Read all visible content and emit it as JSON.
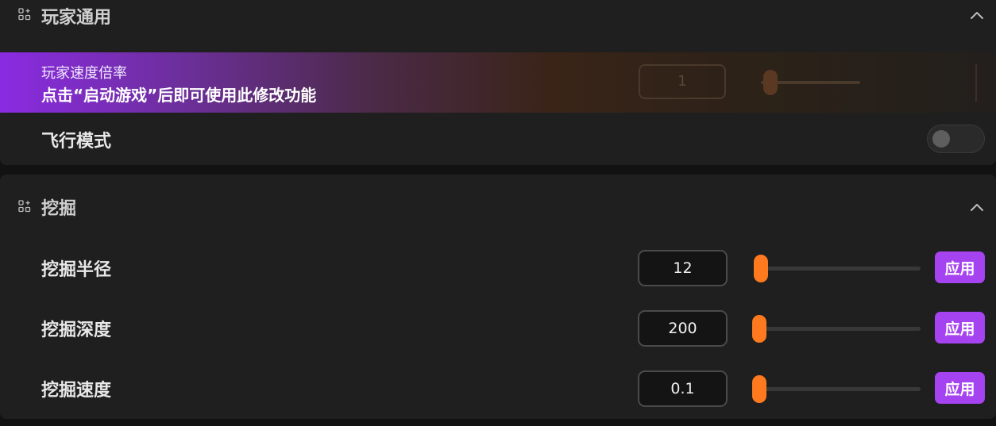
{
  "colors": {
    "accent_purple": "#a543f0",
    "accent_orange": "#ff7a1f",
    "panel_bg": "#1f1f1f",
    "page_bg": "#121212"
  },
  "player_section": {
    "title": "玩家通用",
    "icon": "grid-plus-icon",
    "collapse_icon": "chevron-up-icon",
    "speed_row": {
      "label": "玩家速度倍率",
      "overlay_message": "点击“启动游戏”后即可使用此修改功能",
      "value": "1",
      "slider_fraction": 0.05
    },
    "flight_row": {
      "label": "飞行模式",
      "toggle_on": false
    }
  },
  "dig_section": {
    "title": "挖掘",
    "icon": "grid-plus-icon",
    "collapse_icon": "chevron-up-icon",
    "rows": [
      {
        "label": "挖掘半径",
        "value": "12",
        "slider_fraction": 0.03,
        "apply_label": "应用"
      },
      {
        "label": "挖掘深度",
        "value": "200",
        "slider_fraction": 0.02,
        "apply_label": "应用"
      },
      {
        "label": "挖掘速度",
        "value": "0.1",
        "slider_fraction": 0.02,
        "apply_label": "应用"
      }
    ]
  }
}
